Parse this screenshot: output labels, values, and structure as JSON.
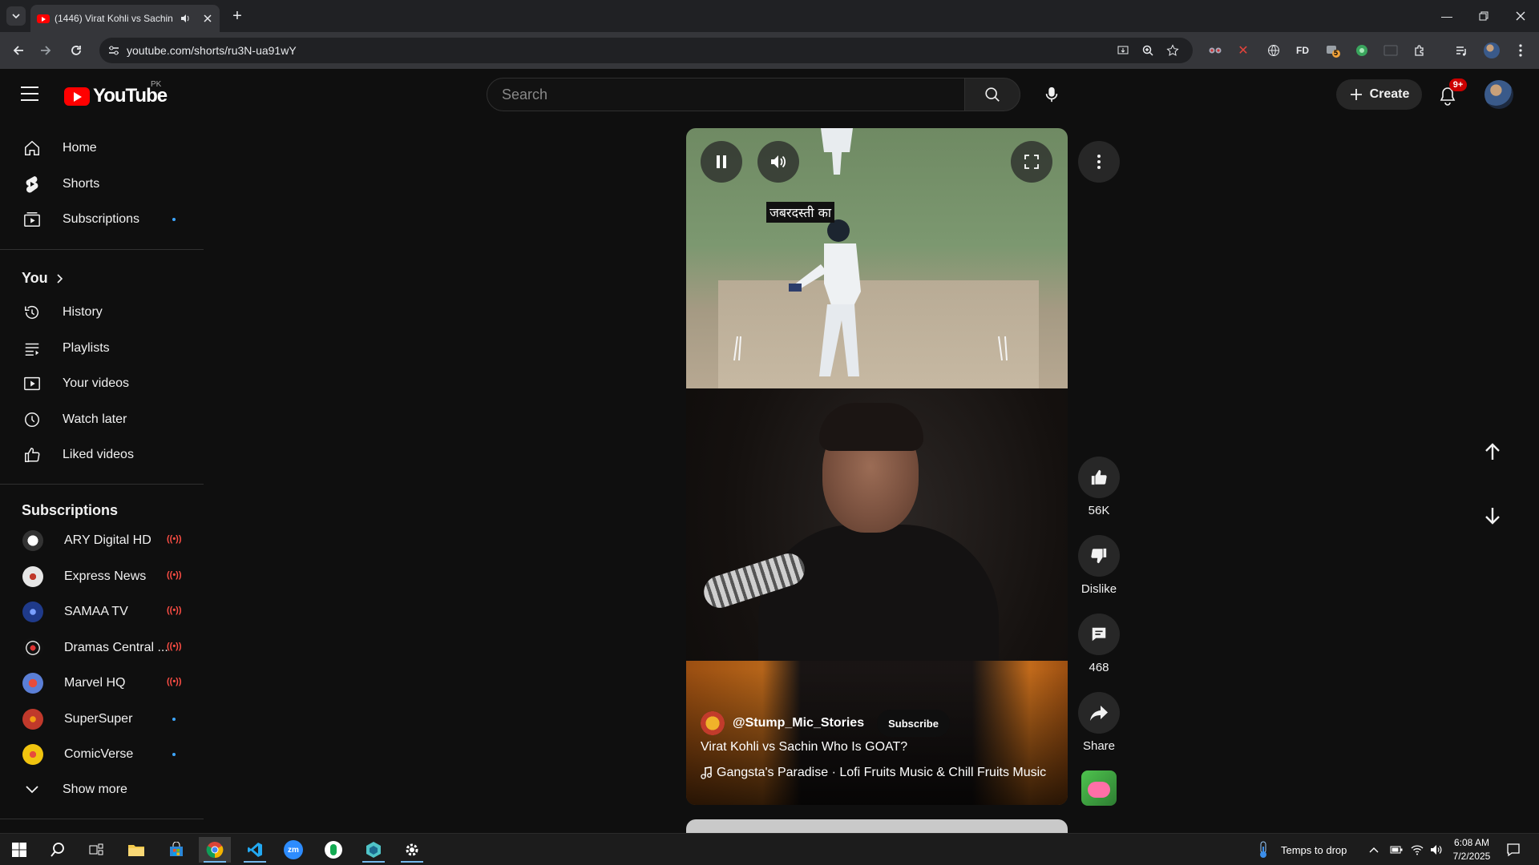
{
  "browser": {
    "tab_title": "(1446) Virat Kohli vs Sachin",
    "new_tab": "+",
    "url": "youtube.com/shorts/ru3N-ua91wY",
    "ext_fd_label": "FD",
    "ext_badge": "5"
  },
  "header": {
    "logo_text": "YouTube",
    "country_code": "PK",
    "search_placeholder": "Search",
    "create_label": "Create",
    "notifications_badge": "9+"
  },
  "sidebar": {
    "main": [
      {
        "label": "Home",
        "icon": "home-icon"
      },
      {
        "label": "Shorts",
        "icon": "shorts-icon"
      },
      {
        "label": "Subscriptions",
        "icon": "subscriptions-icon"
      }
    ],
    "you_heading": "You",
    "you_items": [
      {
        "label": "History",
        "icon": "history-icon"
      },
      {
        "label": "Playlists",
        "icon": "playlists-icon"
      },
      {
        "label": "Your videos",
        "icon": "your-videos-icon"
      },
      {
        "label": "Watch later",
        "icon": "watch-later-icon"
      },
      {
        "label": "Liked videos",
        "icon": "liked-videos-icon"
      }
    ],
    "subs_heading": "Subscriptions",
    "subscriptions": [
      {
        "name": "ARY Digital HD",
        "status": "live",
        "color": "#e8e8e8"
      },
      {
        "name": "Express News",
        "status": "live",
        "color": "#d9d9d9"
      },
      {
        "name": "SAMAA TV",
        "status": "live",
        "color": "#1f3a8a"
      },
      {
        "name": "Dramas Central ...",
        "status": "live",
        "color": "#222222"
      },
      {
        "name": "Marvel HQ",
        "status": "live",
        "color": "#5b7fd6"
      },
      {
        "name": "SuperSuper",
        "status": "new",
        "color": "#c0392b"
      },
      {
        "name": "ComicVerse",
        "status": "new",
        "color": "#f1c40f"
      }
    ],
    "show_more": "Show more"
  },
  "short": {
    "subtitle_text": "जबरदस्ती का",
    "channel_handle": "@Stump_Mic_Stories",
    "subscribe_label": "Subscribe",
    "title": "Virat Kohli vs Sachin Who Is GOAT?",
    "music": "Gangsta's Paradise · Lofi Fruits Music & Chill Fruits Music"
  },
  "actions": {
    "likes": "56K",
    "dislike_label": "Dislike",
    "comments": "468",
    "share_label": "Share"
  },
  "taskbar": {
    "weather_text": "Temps to drop",
    "time": "6:08 AM",
    "date": "7/2/2025",
    "zoom_label": "zm"
  },
  "colors": {
    "accent_red": "#ff0000",
    "background": "#0f0f0f",
    "live_red": "#ff4e45",
    "new_dot_blue": "#3ea6ff"
  }
}
